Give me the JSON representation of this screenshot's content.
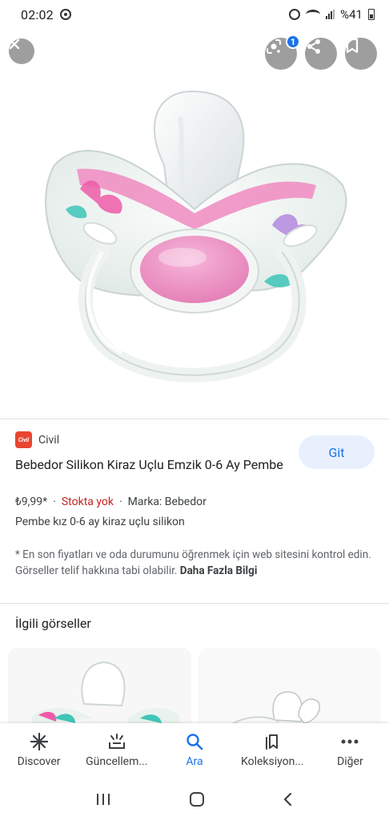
{
  "status_bar": {
    "time": "02:02",
    "battery": "%41"
  },
  "viewer": {
    "lens_badge_count": "1",
    "icons": [
      "close-icon",
      "lens-icon",
      "share-icon",
      "bookmark-icon"
    ]
  },
  "product": {
    "source_logo_text": "Civil",
    "source_name": "Civil",
    "title": "Bebedor Silikon Kiraz Uçlu Emzik 0-6 Ay Pembe",
    "go_label": "Git",
    "price": "₺9,99*",
    "separator": "·",
    "stock": "Stokta yok",
    "brand": "Marka: Bebedor",
    "description": "Pembe kız 0-6 ay kiraz uçlu silikon",
    "disclaimer": "* En son fiyatları ve oda durumunu öğrenmek için web sitesini kontrol edin. Görseller telif hakkına tabi olabilir.",
    "more_info": "Daha Fazla Bilgi"
  },
  "related": {
    "title": "İlgili görseller"
  },
  "bottom_nav": [
    {
      "label": "Discover",
      "icon": "asterisk-icon"
    },
    {
      "label": "Güncellem...",
      "icon": "updates-icon"
    },
    {
      "label": "Ara",
      "icon": "search-icon"
    },
    {
      "label": "Koleksiyon...",
      "icon": "collections-icon"
    },
    {
      "label": "Diğer",
      "icon": "more-icon"
    }
  ],
  "colors": {
    "accent": "#1a73e8",
    "stock": "#c5221f",
    "pacifier_pink": "#f08bc0"
  }
}
